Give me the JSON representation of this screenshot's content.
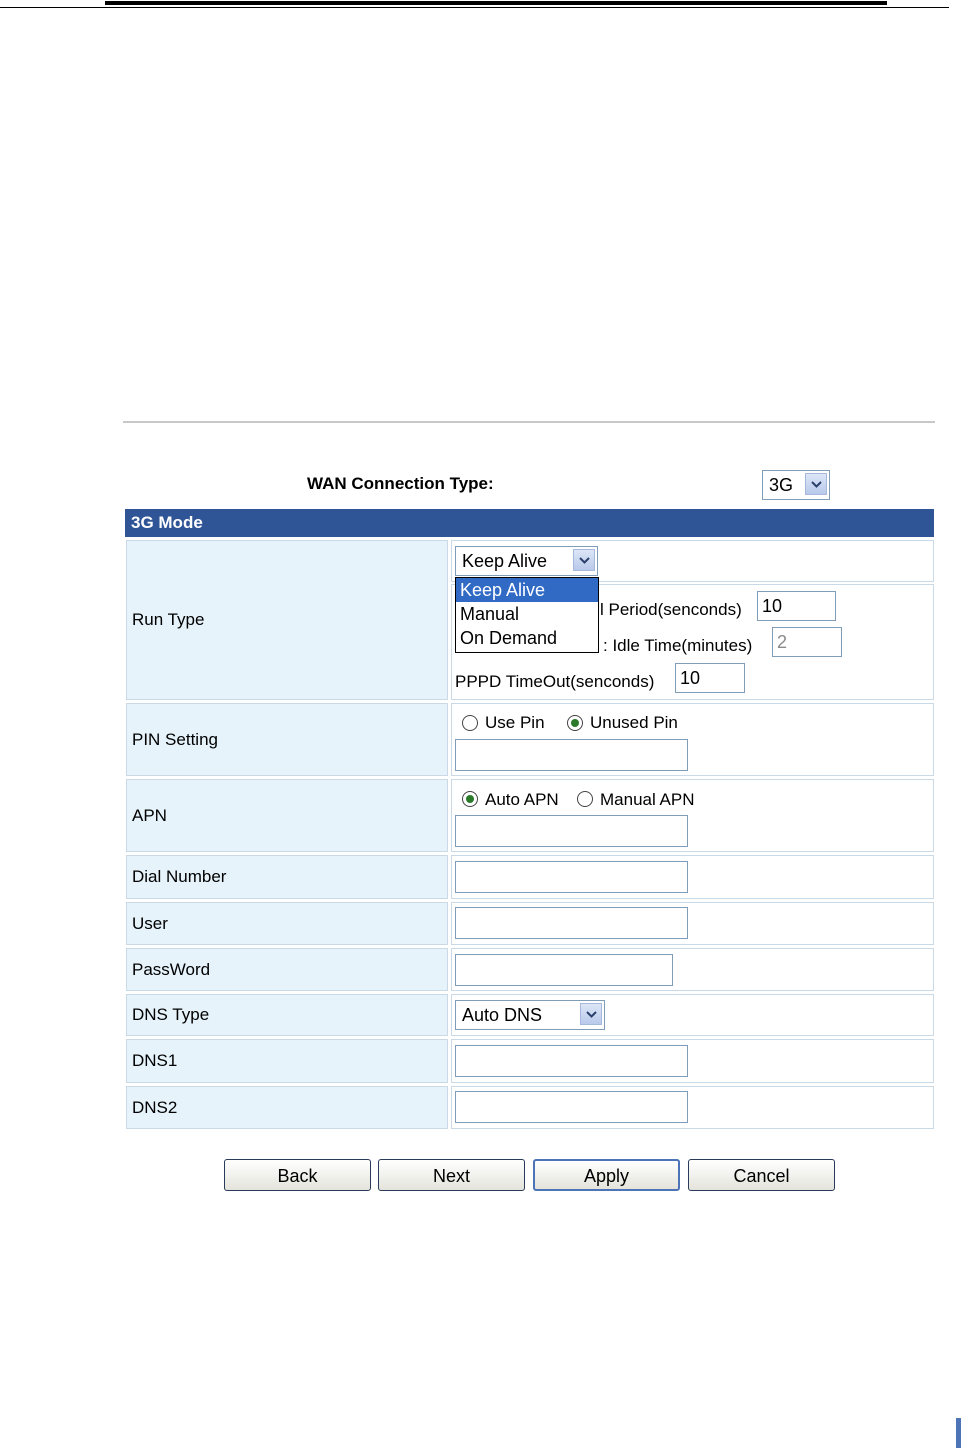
{
  "wan": {
    "label": "WAN Connection Type:",
    "value": "3G"
  },
  "section_title": "3G Mode",
  "run_type": {
    "label": "Run Type",
    "select_value": "Keep Alive",
    "options": [
      "Keep Alive",
      "Manual",
      "On Demand"
    ],
    "period_label": "l Period(senconds)",
    "period_value": "10",
    "idle_label": ": Idle Time(minutes)",
    "idle_value": "2",
    "pppd_label": "PPPD TimeOut(senconds)",
    "pppd_value": "10"
  },
  "pin": {
    "label": "PIN Setting",
    "use_label": "Use Pin",
    "unused_label": "Unused Pin",
    "selected": "unused",
    "value": ""
  },
  "apn": {
    "label": "APN",
    "auto_label": "Auto APN",
    "manual_label": "Manual APN",
    "selected": "auto",
    "value": ""
  },
  "dial": {
    "label": "Dial Number",
    "value": ""
  },
  "user": {
    "label": "User",
    "value": ""
  },
  "password": {
    "label": "PassWord",
    "value": ""
  },
  "dns_type": {
    "label": "DNS Type",
    "value": "Auto DNS"
  },
  "dns1": {
    "label": "DNS1",
    "value": ""
  },
  "dns2": {
    "label": "DNS2",
    "value": ""
  },
  "buttons": {
    "back": "Back",
    "next": "Next",
    "apply": "Apply",
    "cancel": "Cancel"
  },
  "colors": {
    "header": "#2f5597",
    "label_bg": "#e6f3fb",
    "selection": "#316ac5"
  }
}
